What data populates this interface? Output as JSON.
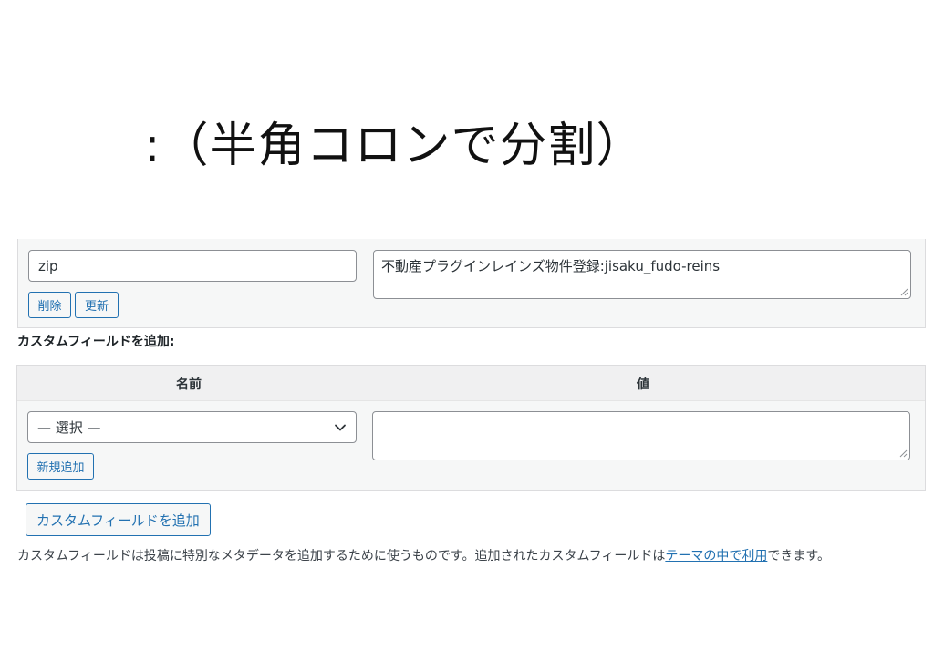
{
  "heading": {
    "text": ":（半角コロンで分割）"
  },
  "existing_field": {
    "name_value": "zip",
    "value_text": "不動産プラグインレインズ物件登録:jisaku_fudo-reins",
    "delete_label": "削除",
    "update_label": "更新"
  },
  "add_section": {
    "label": "カスタムフィールドを追加:",
    "col_name": "名前",
    "col_value": "値",
    "select_value": "— 選択 —",
    "value_text": "",
    "new_button_label": "新規追加"
  },
  "add_button": {
    "label": "カスタムフィールドを追加"
  },
  "help": {
    "before": "カスタムフィールドは投稿に特別なメタデータを追加するために使うものです。追加されたカスタムフィールドは",
    "link": "テーマの中で利用",
    "after": "できます。"
  }
}
